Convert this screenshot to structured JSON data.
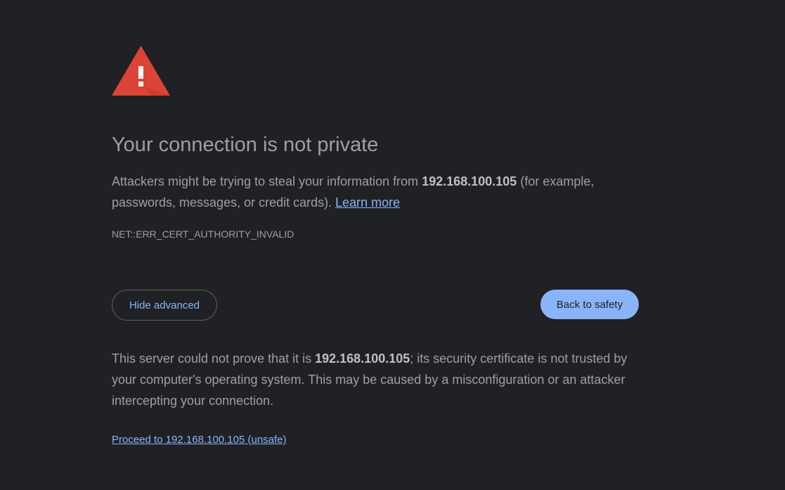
{
  "page": {
    "background": "#202124",
    "accent": "#8ab4f8",
    "warning_color": "#db4437"
  },
  "icon": {
    "name": "warning-triangle-icon"
  },
  "title": "Your connection is not private",
  "summary": {
    "before": "Attackers might be trying to steal your information from ",
    "host": "192.168.100.105",
    "after": " (for example, passwords, messages, or credit cards). ",
    "learn_more": "Learn more"
  },
  "error_code": "NET::ERR_CERT_AUTHORITY_INVALID",
  "buttons": {
    "hide_advanced": "Hide advanced",
    "back_to_safety": "Back to safety"
  },
  "details": {
    "before": "This server could not prove that it is ",
    "host": "192.168.100.105",
    "after": "; its security certificate is not trusted by your computer's operating system. This may be caused by a misconfiguration or an attacker intercepting your connection."
  },
  "proceed_link": "Proceed to 192.168.100.105 (unsafe)"
}
